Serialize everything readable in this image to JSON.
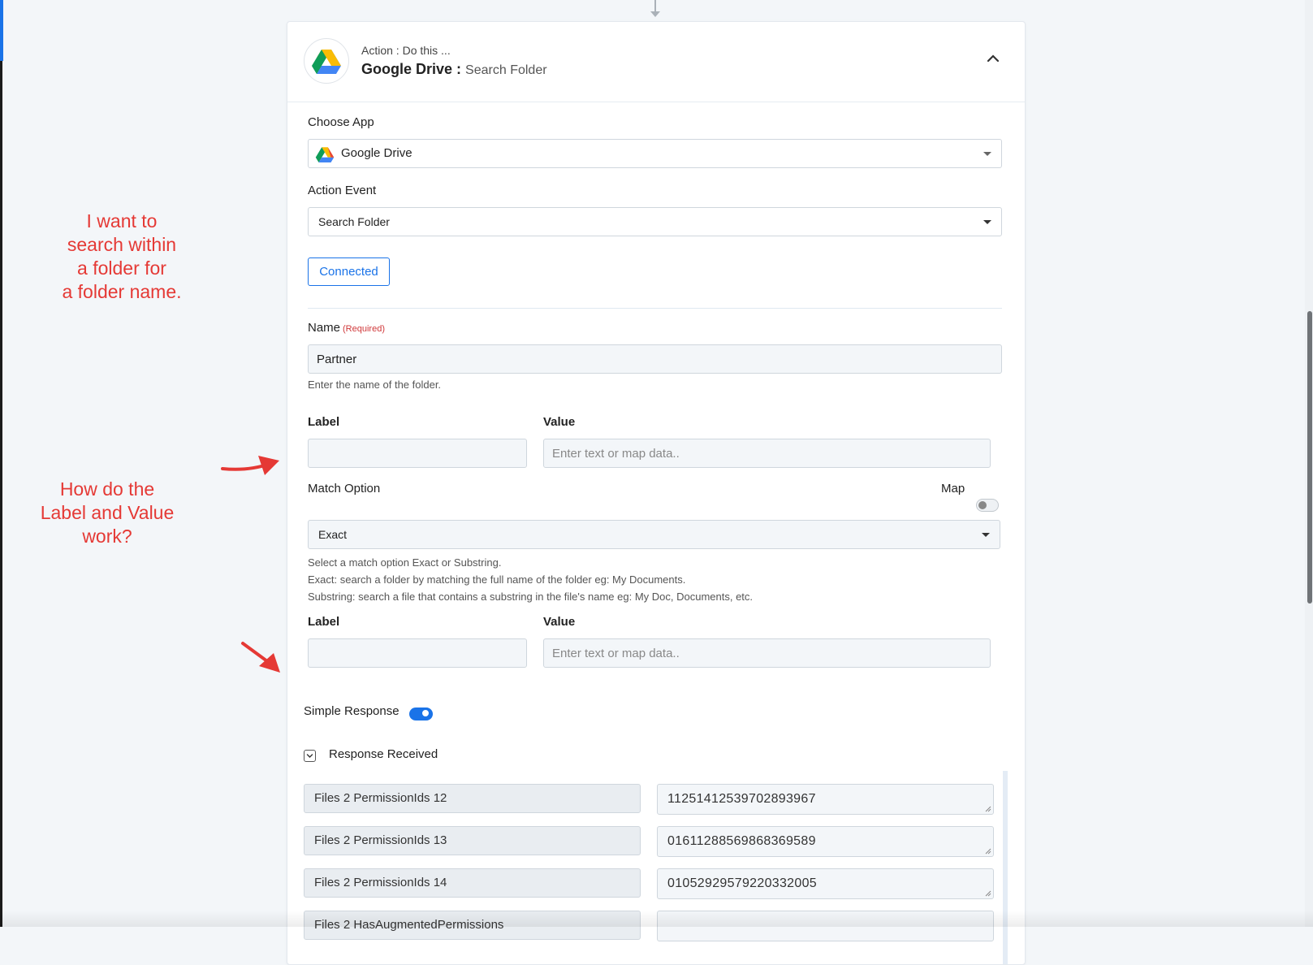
{
  "step": {
    "subtitle": "Action : Do this ...",
    "app_name": "Google Drive :",
    "event_name": "Search Folder"
  },
  "form": {
    "choose_app_label": "Choose App",
    "choose_app_value": "Google Drive",
    "action_event_label": "Action Event",
    "action_event_value": "Search Folder",
    "connected_button": "Connected",
    "name_label": "Name",
    "name_required": "(Required)",
    "name_value": "Partner",
    "name_help": "Enter the name of the folder.",
    "label_1": "Label",
    "value_1": "Value",
    "value_placeholder_1": "Enter text or map data..",
    "match_option_label": "Match Option",
    "map_label": "Map",
    "match_option_value": "Exact",
    "match_help_1": "Select a match option Exact or Substring.",
    "match_help_2": "Exact: search a folder by matching the full name of the folder eg: My Documents.",
    "match_help_3": "Substring: search a file that contains a substring in the file's name eg: My Doc, Documents, etc.",
    "label_2": "Label",
    "value_2": "Value",
    "value_placeholder_2": "Enter text or map data..",
    "simple_response_label": "Simple Response",
    "simple_response_on": true,
    "response_received_label": "Response Received"
  },
  "responses": [
    {
      "field": "Files 2 PermissionIds 12",
      "value": "11251412539702893967"
    },
    {
      "field": "Files 2 PermissionIds 13",
      "value": "01611288569868369589"
    },
    {
      "field": "Files 2 PermissionIds 14",
      "value": "01052929579220332005"
    },
    {
      "field": "Files 2 HasAugmentedPermissions",
      "value": ""
    }
  ],
  "annotations": {
    "note_1": "I want to\nsearch within\na folder for\na folder name.",
    "note_2": "How do the\nLabel and Value\nwork?"
  },
  "colors": {
    "accent": "#1a73e8",
    "annotation": "#e53935",
    "required": "#d0383a"
  }
}
